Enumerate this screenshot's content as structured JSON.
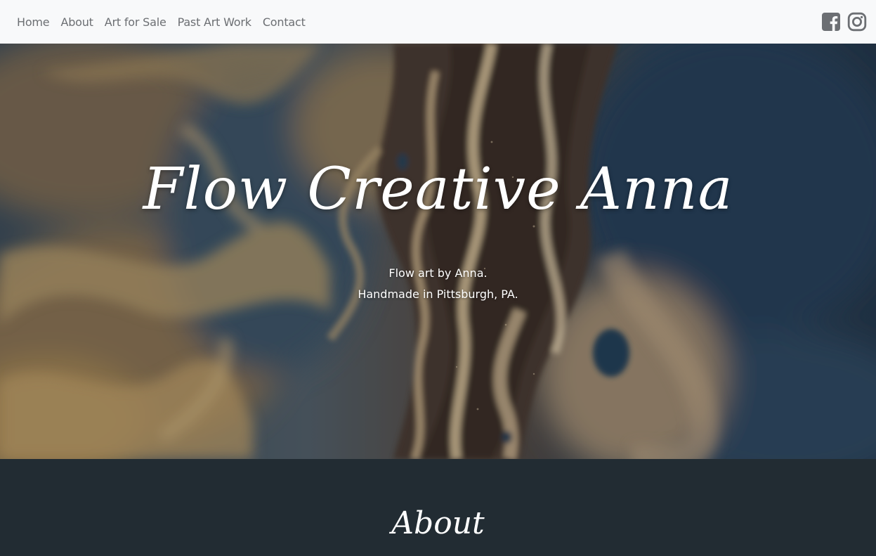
{
  "nav": {
    "links": [
      "Home",
      "About",
      "Art for Sale",
      "Past Art Work",
      "Contact"
    ],
    "social_icons": [
      "facebook-square-icon",
      "instagram-icon"
    ]
  },
  "hero": {
    "title": "Flow Creative Anna",
    "subtitle_line1": "Flow art by Anna.",
    "subtitle_line2": "Handmade in Pittsburgh, PA."
  },
  "about": {
    "heading": "About"
  },
  "colors": {
    "navbar_bg": "#f8f9fa",
    "nav_link": "#6c6f73",
    "icon": "#6c6f73",
    "section_bg": "#222c33",
    "hero_text": "#ffffff"
  }
}
